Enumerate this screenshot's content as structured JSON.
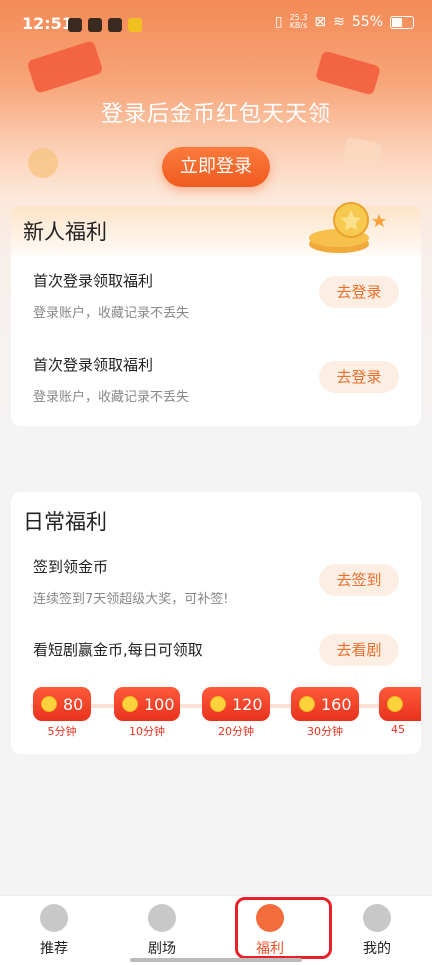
{
  "status": {
    "time": "12:51",
    "speed_top": "25.3",
    "speed_bottom": "KB/s",
    "battery": "55%"
  },
  "hero": {
    "headline": "登录后金币红包天天领",
    "login_button": "立即登录"
  },
  "newbie": {
    "title": "新人福利",
    "rows": [
      {
        "title": "首次登录领取福利",
        "sub": "登录账户，收藏记录不丢失",
        "button": "去登录"
      },
      {
        "title": "首次登录领取福利",
        "sub": "登录账户，收藏记录不丢失",
        "button": "去登录"
      }
    ]
  },
  "daily": {
    "title": "日常福利",
    "checkin": {
      "title": "签到领金币",
      "sub": "连续签到7天领超级大奖，可补签!",
      "button": "去签到"
    },
    "watch": {
      "title": "看短剧赢金币,每日可领取",
      "button": "去看剧"
    },
    "rewards": [
      {
        "value": "80",
        "label": "5分钟"
      },
      {
        "value": "100",
        "label": "10分钟"
      },
      {
        "value": "120",
        "label": "20分钟"
      },
      {
        "value": "160",
        "label": "30分钟"
      },
      {
        "value": "",
        "label": "45"
      }
    ]
  },
  "tabs": [
    {
      "label": "推荐",
      "icon": "flame-icon"
    },
    {
      "label": "剧场",
      "icon": "film-reel-icon"
    },
    {
      "label": "福利",
      "icon": "money-bag-icon"
    },
    {
      "label": "我的",
      "icon": "profile-face-icon"
    }
  ],
  "colors": {
    "accent": "#f05a1f",
    "pill_text": "#e8702c",
    "reward_red": "#e8321e",
    "highlight_box": "#e8202a"
  }
}
